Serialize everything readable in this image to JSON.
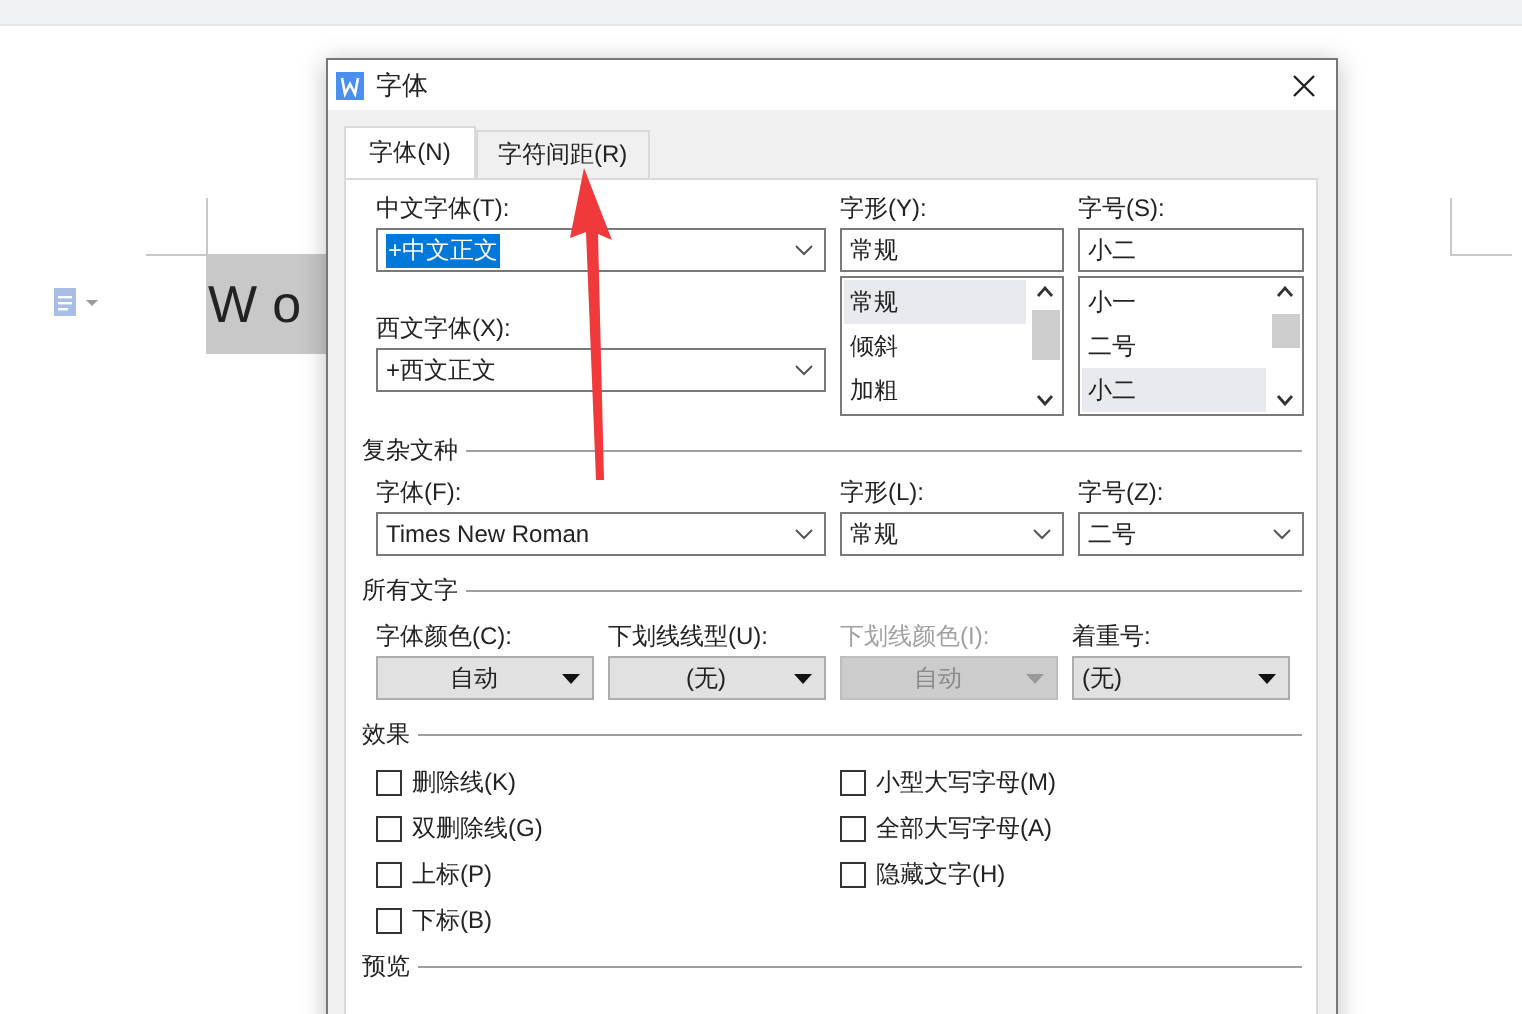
{
  "document": {
    "text": "Wo"
  },
  "window": {
    "title": "字体"
  },
  "tabs": [
    {
      "label": "字体(N)",
      "selected": true
    },
    {
      "label": "字符间距(R)",
      "selected": false
    }
  ],
  "font": {
    "chinese_font": {
      "label": "中文字体(T):",
      "value": "+中文正文",
      "selected": true
    },
    "western_font": {
      "label": "西文字体(X):",
      "value": "+西文正文",
      "selected": false
    },
    "style": {
      "label": "字形(Y):",
      "value": "常规",
      "options": [
        {
          "label": "常规",
          "selected": true
        },
        {
          "label": "倾斜",
          "selected": false
        },
        {
          "label": "加粗",
          "selected": false
        }
      ]
    },
    "size": {
      "label": "字号(S):",
      "value": "小二",
      "options": [
        {
          "label": "小一",
          "selected": false
        },
        {
          "label": "二号",
          "selected": false
        },
        {
          "label": "小二",
          "selected": true
        }
      ]
    }
  },
  "complex_script": {
    "title": "复杂文种",
    "fields": [
      {
        "label": "字体(F):",
        "value": "Times New Roman"
      },
      {
        "label": "字形(L):",
        "value": "常规"
      },
      {
        "label": "字号(Z):",
        "value": "二号"
      }
    ]
  },
  "all_text": {
    "title": "所有文字",
    "fields": [
      {
        "label": "字体颜色(C):",
        "value": "自动",
        "disabled": false
      },
      {
        "label": "下划线线型(U):",
        "value": "(无)",
        "disabled": false
      },
      {
        "label": "下划线颜色(I):",
        "value": "自动",
        "disabled": true
      },
      {
        "label": "着重号:",
        "value": "(无)",
        "disabled": false
      }
    ]
  },
  "effects": {
    "title": "效果",
    "options": [
      {
        "label": "删除线(K)",
        "checked": false
      },
      {
        "label": "双删除线(G)",
        "checked": false
      },
      {
        "label": "上标(P)",
        "checked": false
      },
      {
        "label": "下标(B)",
        "checked": false
      },
      {
        "label": "小型大写字母(M)",
        "checked": false
      },
      {
        "label": "全部大写字母(A)",
        "checked": false
      },
      {
        "label": "隐藏文字(H)",
        "checked": false
      }
    ]
  },
  "preview": {
    "title": "预览"
  }
}
